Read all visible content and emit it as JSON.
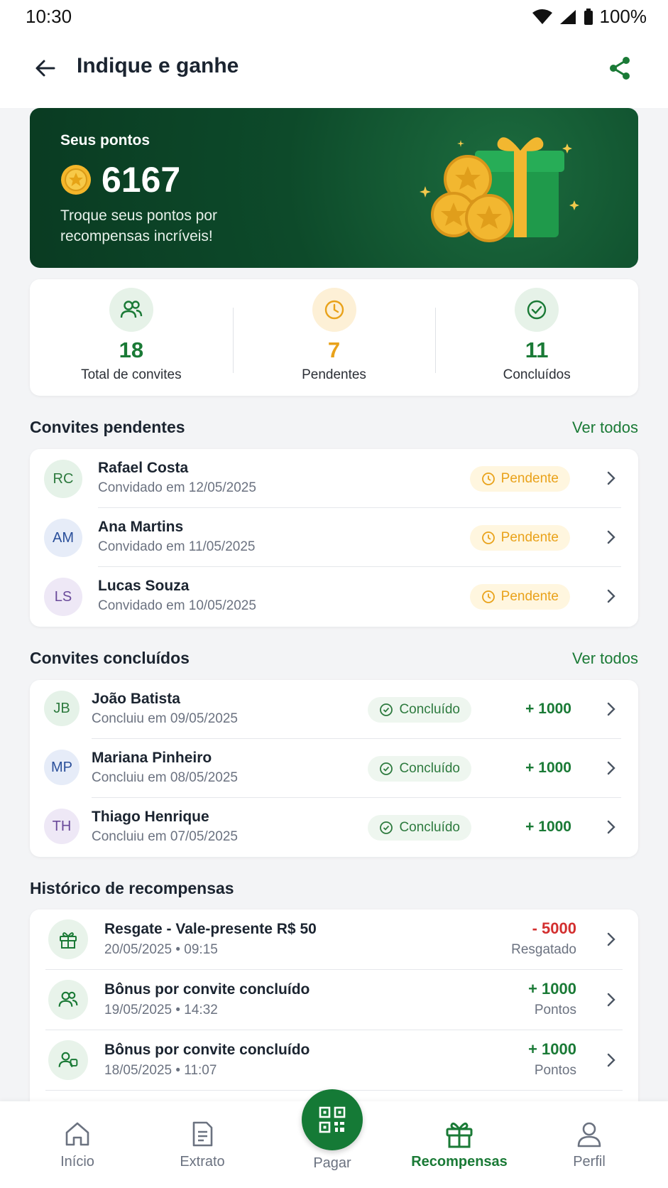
{
  "status": {
    "time": "10:30",
    "battery": "100%"
  },
  "appbar": {
    "title": "Indique e ganhe"
  },
  "hero": {
    "label": "Seus pontos",
    "points": "6167",
    "description": "Troque seus pontos por recompensas incríveis!"
  },
  "stats": [
    {
      "value": "18",
      "caption": "Total de convites",
      "color": "#1a7a36"
    },
    {
      "value": "7",
      "caption": "Pendentes",
      "color": "#e9a21a"
    },
    {
      "value": "11",
      "caption": "Concluídos",
      "color": "#1a7a36"
    }
  ],
  "pending": {
    "title": "Convites pendentes",
    "see_all": "Ver todos",
    "items": [
      {
        "initials": "RC",
        "name": "Rafael Costa",
        "sub": "Convidado em 12/05/2025",
        "badge": "Pendente"
      },
      {
        "initials": "AM",
        "name": "Ana Martins",
        "sub": "Convidado em 11/05/2025",
        "badge": "Pendente"
      },
      {
        "initials": "LS",
        "name": "Lucas Souza",
        "sub": "Convidado em 10/05/2025",
        "badge": "Pendente"
      }
    ]
  },
  "completed": {
    "title": "Convites concluídos",
    "see_all": "Ver todos",
    "items": [
      {
        "initials": "JB",
        "name": "João Batista",
        "sub": "Concluiu em 09/05/2025",
        "badge": "Concluído",
        "points": "+ 1000"
      },
      {
        "initials": "MP",
        "name": "Mariana Pinheiro",
        "sub": "Concluiu em 08/05/2025",
        "badge": "Concluído",
        "points": "+ 1000"
      },
      {
        "initials": "TH",
        "name": "Thiago Henrique",
        "sub": "Concluiu em 07/05/2025",
        "badge": "Concluído",
        "points": "+ 1000"
      }
    ]
  },
  "history": {
    "title": "Histórico de recompensas",
    "items": [
      {
        "name": "Resgate - Vale-presente R$ 50",
        "sub": "20/05/2025 • 09:15",
        "amount": "- 5000",
        "kind": "Resgatado",
        "color": "#d32f2f"
      },
      {
        "name": "Bônus por convite concluído",
        "sub": "19/05/2025 • 14:32",
        "amount": "+ 1000",
        "kind": "Pontos",
        "color": "#1a7a36"
      },
      {
        "name": "Bônus por convite concluído",
        "sub": "18/05/2025 • 11:07",
        "amount": "+ 1000",
        "kind": "Pontos",
        "color": "#1a7a36"
      }
    ]
  },
  "nav": {
    "home": "Início",
    "statement": "Extrato",
    "pay": "Pagar",
    "rewards": "Recompensas",
    "profile": "Perfil"
  }
}
